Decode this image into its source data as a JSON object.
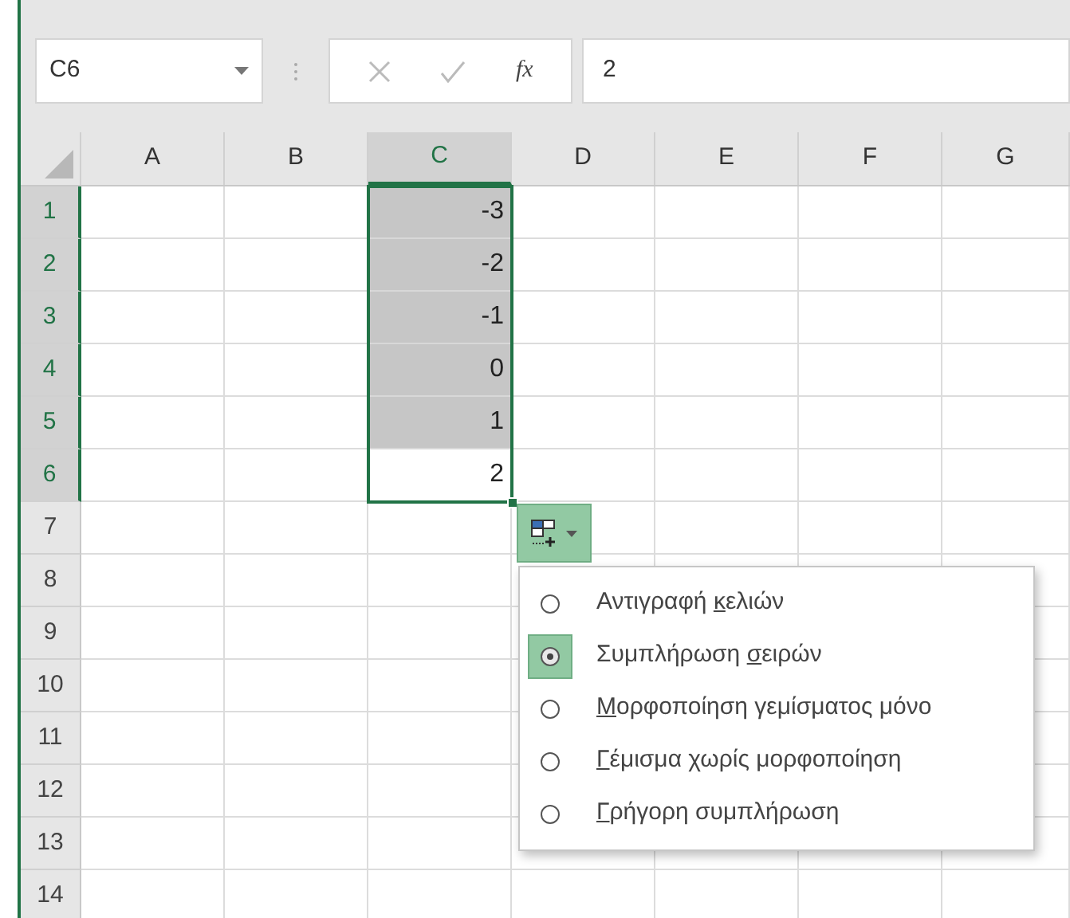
{
  "formula_bar": {
    "name_box": "C6",
    "fx": "fx",
    "value": "2"
  },
  "columns": [
    {
      "label": "A",
      "selected": false
    },
    {
      "label": "B",
      "selected": false
    },
    {
      "label": "C",
      "selected": true
    },
    {
      "label": "D",
      "selected": false
    },
    {
      "label": "E",
      "selected": false
    },
    {
      "label": "F",
      "selected": false
    },
    {
      "label": "G",
      "selected": false
    }
  ],
  "rows": [
    {
      "label": "1",
      "selected": true,
      "c": {
        "value": "-3",
        "shaded": true
      }
    },
    {
      "label": "2",
      "selected": true,
      "c": {
        "value": "-2",
        "shaded": true
      }
    },
    {
      "label": "3",
      "selected": true,
      "c": {
        "value": "-1",
        "shaded": true
      }
    },
    {
      "label": "4",
      "selected": true,
      "c": {
        "value": "0",
        "shaded": true
      }
    },
    {
      "label": "5",
      "selected": true,
      "c": {
        "value": "1",
        "shaded": true
      }
    },
    {
      "label": "6",
      "selected": true,
      "c": {
        "value": "2",
        "shaded": false
      }
    },
    {
      "label": "7",
      "selected": false
    },
    {
      "label": "8",
      "selected": false
    },
    {
      "label": "9",
      "selected": false
    },
    {
      "label": "10",
      "selected": false
    },
    {
      "label": "11",
      "selected": false
    },
    {
      "label": "12",
      "selected": false
    },
    {
      "label": "13",
      "selected": false
    },
    {
      "label": "14",
      "selected": false
    }
  ],
  "autofill_menu": [
    {
      "before": "Αντιγραφή ",
      "key": "κ",
      "after": "ελιών",
      "selected": false
    },
    {
      "before": "Συμπλήρωση ",
      "key": "σ",
      "after": "ειρών",
      "selected": true
    },
    {
      "key": "Μ",
      "after": "ορφοποίηση γεμίσματος μόνο",
      "selected": false
    },
    {
      "key": "Γ",
      "after": "έμισμα χωρίς μορφοποίηση",
      "selected": false
    },
    {
      "key": "Γ",
      "after": "ρήγορη συμπλήρωση",
      "selected": false
    }
  ]
}
